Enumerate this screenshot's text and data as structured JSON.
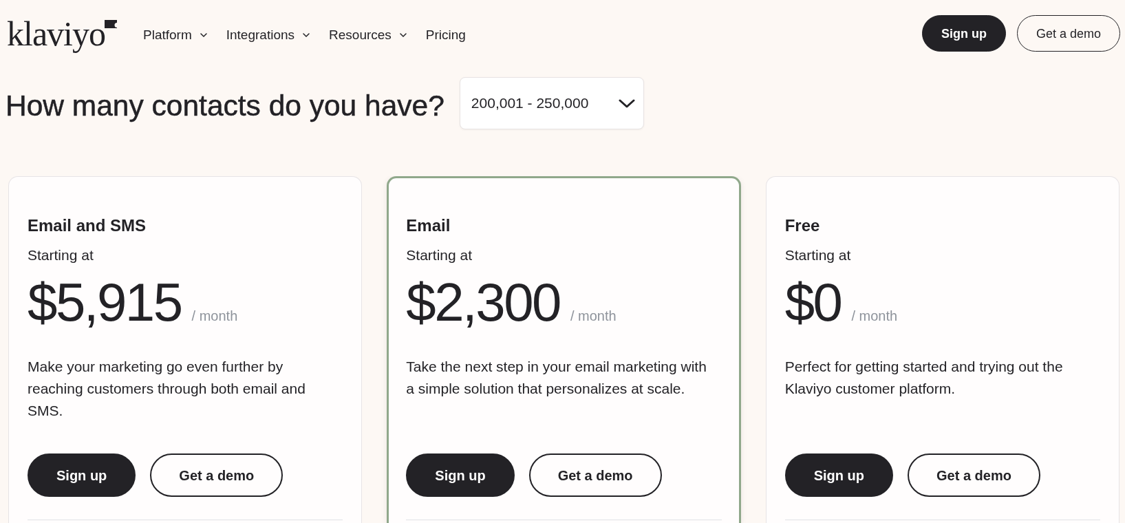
{
  "header": {
    "brand": "klaviyo",
    "nav": [
      {
        "label": "Platform",
        "has_menu": true
      },
      {
        "label": "Integrations",
        "has_menu": true
      },
      {
        "label": "Resources",
        "has_menu": true
      },
      {
        "label": "Pricing",
        "has_menu": false
      }
    ],
    "actions": [
      {
        "label": "Sign up",
        "kind": "primary"
      },
      {
        "label": "Get a demo",
        "kind": "outline"
      }
    ]
  },
  "contacts": {
    "question": "How many contacts do you have?",
    "value": "200,001 - 250,000"
  },
  "plans": [
    {
      "name": "Email and SMS",
      "label": "Starting at",
      "price": "$5,915",
      "period": "/ month",
      "description": "Make your marketing go even further by reaching customers through both email and SMS.",
      "highlighted": false,
      "buttons": [
        {
          "label": "Sign up",
          "kind": "primary"
        },
        {
          "label": "Get a demo",
          "kind": "outline"
        }
      ]
    },
    {
      "name": "Email",
      "label": "Starting at",
      "price": "$2,300",
      "period": "/ month",
      "description": "Take the next step in your email marketing with a simple solution that personalizes at scale.",
      "highlighted": true,
      "buttons": [
        {
          "label": "Sign up",
          "kind": "primary"
        },
        {
          "label": "Get a demo",
          "kind": "outline"
        }
      ]
    },
    {
      "name": "Free",
      "label": "Starting at",
      "price": "$0",
      "period": "/ month",
      "description": "Perfect for getting started and trying out the Klaviyo customer platform.",
      "highlighted": false,
      "buttons": [
        {
          "label": "Sign up",
          "kind": "primary"
        },
        {
          "label": "Get a demo",
          "kind": "outline"
        }
      ]
    }
  ]
}
